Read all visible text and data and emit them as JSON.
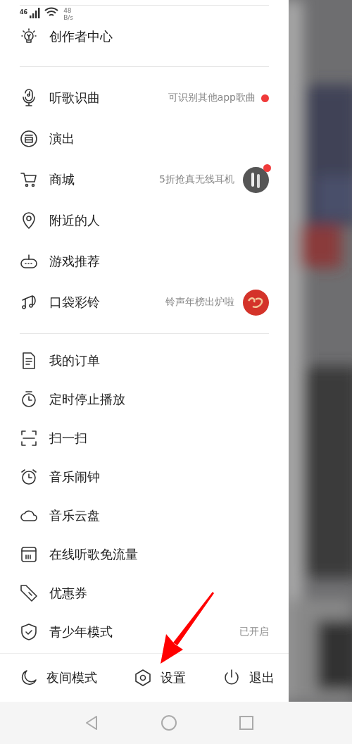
{
  "status_bar": {
    "network": "46",
    "speed": "48",
    "speed_unit": "B/s"
  },
  "sections": [
    {
      "items": [
        {
          "label": "创作者中心",
          "kind": "plain"
        }
      ]
    },
    {
      "items": [
        {
          "label": "听歌识曲",
          "hint": "可识别其他app歌曲",
          "kind": "dot"
        },
        {
          "label": "演出",
          "kind": "plain"
        },
        {
          "label": "商城",
          "hint": "5折抢真无线耳机",
          "kind": "picture",
          "badge_dot": true
        },
        {
          "label": "附近的人",
          "kind": "plain"
        },
        {
          "label": "游戏推荐",
          "kind": "plain"
        },
        {
          "label": "口袋彩铃",
          "hint": "铃声年榜出炉啦",
          "kind": "picture",
          "badge_dot": false
        }
      ]
    },
    {
      "items": [
        {
          "label": "我的订单",
          "kind": "plain"
        },
        {
          "label": "定时停止播放",
          "kind": "plain"
        },
        {
          "label": "扫一扫",
          "kind": "plain"
        },
        {
          "label": "音乐闹钟",
          "kind": "plain"
        },
        {
          "label": "音乐云盘",
          "kind": "plain"
        },
        {
          "label": "在线听歌免流量",
          "kind": "plain"
        },
        {
          "label": "优惠券",
          "kind": "plain"
        },
        {
          "label": "青少年模式",
          "hint": "已开启",
          "kind": "plain"
        }
      ]
    }
  ],
  "bottom_bar": [
    {
      "label": "夜间模式"
    },
    {
      "label": "设置"
    },
    {
      "label": "退出"
    }
  ]
}
